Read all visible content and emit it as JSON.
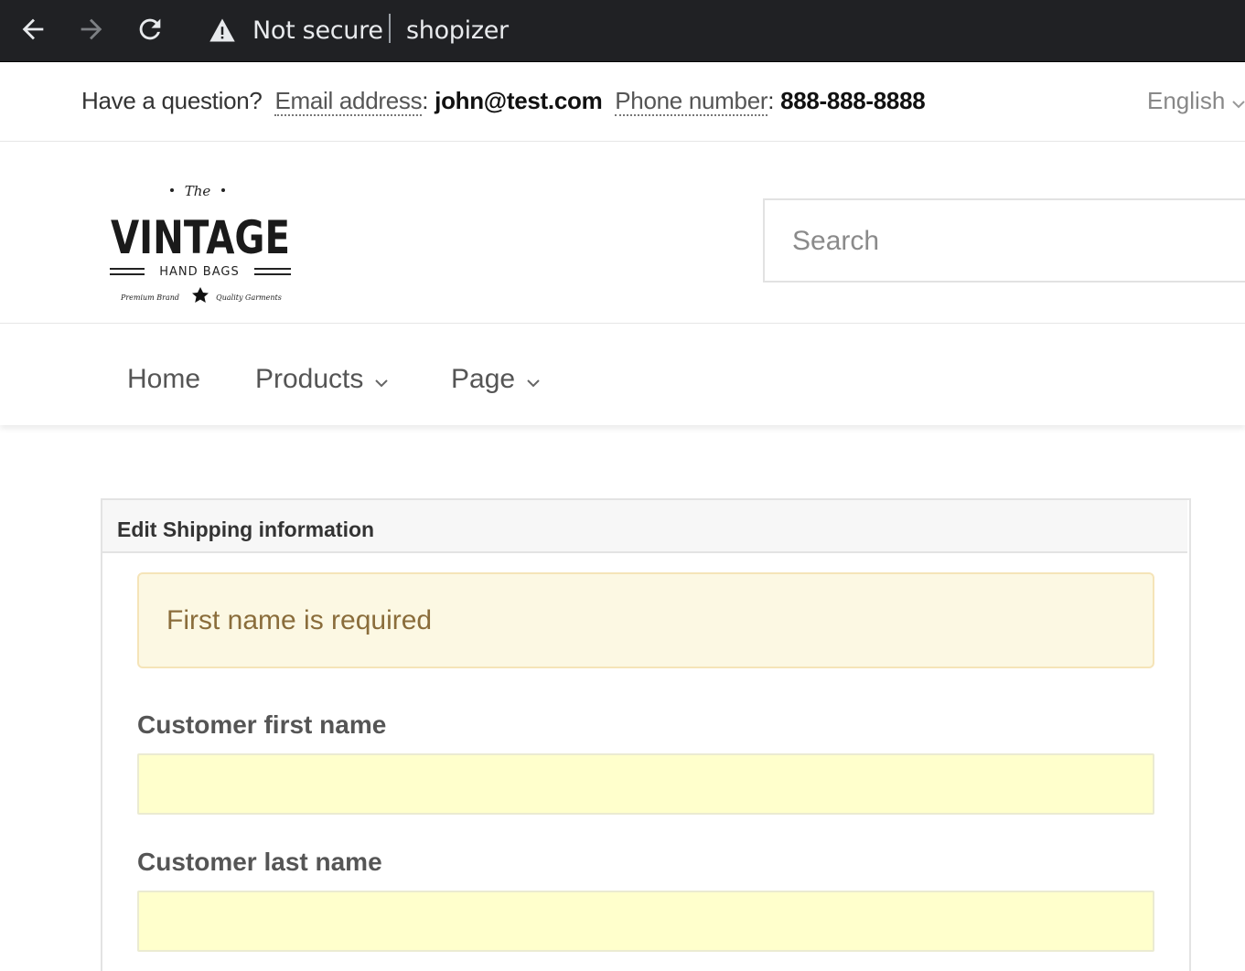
{
  "browser": {
    "security_label": "Not secure",
    "url": "shopizer",
    "icons": [
      "back-arrow-icon",
      "forward-arrow-icon",
      "reload-icon",
      "warning-icon"
    ]
  },
  "contact": {
    "question": "Have a question?",
    "email_label": "Email address",
    "email_value": "john@test.com",
    "phone_label": "Phone number",
    "phone_value": "888-888-8888",
    "language": "English"
  },
  "logo": {
    "top_text": "The",
    "main_text": "VINTAGE",
    "sub_text": "HAND BAGS",
    "left_tag": "Premium Brand",
    "right_tag": "Quality Garments"
  },
  "search": {
    "placeholder": "Search"
  },
  "nav": {
    "home": "Home",
    "products": "Products",
    "page": "Page"
  },
  "form": {
    "title": "Edit Shipping information",
    "alert": "First name is required",
    "first_name_label": "Customer first name",
    "first_name_value": "",
    "last_name_label": "Customer last name",
    "last_name_value": ""
  },
  "colors": {
    "browser_bg": "#202124",
    "alert_bg": "#fcf8e3",
    "alert_text": "#8a6d3b",
    "input_bg": "#ffffcc"
  }
}
